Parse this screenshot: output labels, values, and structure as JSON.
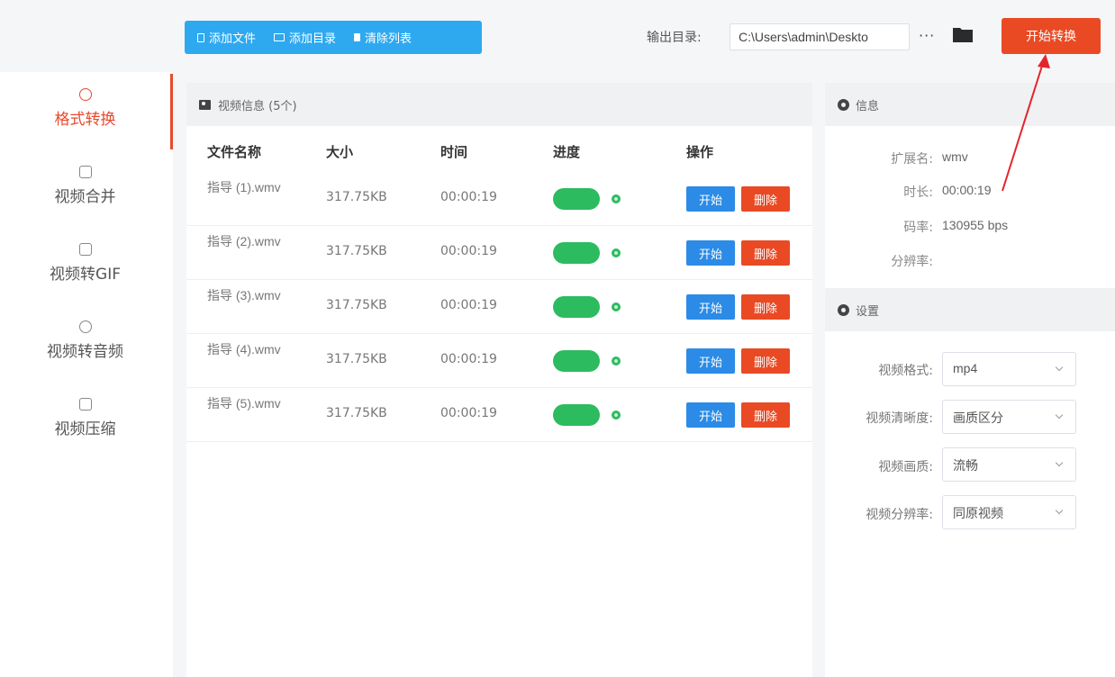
{
  "toolbar": {
    "add_file": "添加文件",
    "add_dir": "添加目录",
    "clear_list": "清除列表"
  },
  "output": {
    "label": "输出目录:",
    "path": "C:\\Users\\admin\\Deskto",
    "more": "···",
    "start_convert": "开始转换"
  },
  "sidebar": {
    "items": [
      {
        "label": "格式转换",
        "icon": "swap-icon",
        "active": true
      },
      {
        "label": "视频合并",
        "icon": "merge-icon"
      },
      {
        "label": "视频转GIF",
        "icon": "gif-icon"
      },
      {
        "label": "视频转音频",
        "icon": "audio-icon"
      },
      {
        "label": "视频压缩",
        "icon": "compress-icon"
      }
    ]
  },
  "video_panel": {
    "title": "视频信息 (5个)",
    "columns": [
      "文件名称",
      "大小",
      "时间",
      "进度",
      "操作"
    ],
    "rows": [
      {
        "name": "指导 (1).wmv",
        "size": "317.75KB",
        "time": "00:00:19",
        "progress": 1.0
      },
      {
        "name": "指导 (2).wmv",
        "size": "317.75KB",
        "time": "00:00:19",
        "progress": 1.0
      },
      {
        "name": "指导 (3).wmv",
        "size": "317.75KB",
        "time": "00:00:19",
        "progress": 1.0
      },
      {
        "name": "指导 (4).wmv",
        "size": "317.75KB",
        "time": "00:00:19",
        "progress": 1.0
      },
      {
        "name": "指导 (5).wmv",
        "size": "317.75KB",
        "time": "00:00:19",
        "progress": 1.0
      }
    ],
    "start_label": "开始",
    "delete_label": "删除"
  },
  "info": {
    "title": "信息",
    "ext_label": "扩展名:",
    "ext": "wmv",
    "duration_label": "时长:",
    "duration": "00:00:19",
    "bitrate_label": "码率:",
    "bitrate": "130955 bps",
    "resolution_label": "分辨率:",
    "resolution": ""
  },
  "settings": {
    "title": "设置",
    "format_label": "视频格式:",
    "format": "mp4",
    "clarity_label": "视频清晰度:",
    "clarity": "画质区分",
    "quality_label": "视频画质:",
    "quality": "流畅",
    "res_label": "视频分辨率:",
    "res": "同原视频"
  },
  "colors": {
    "accent_red": "#e94a24",
    "toolbar_blue": "#2ea9f0",
    "start_blue": "#2b8be6",
    "progress_green": "#2dbb60"
  }
}
